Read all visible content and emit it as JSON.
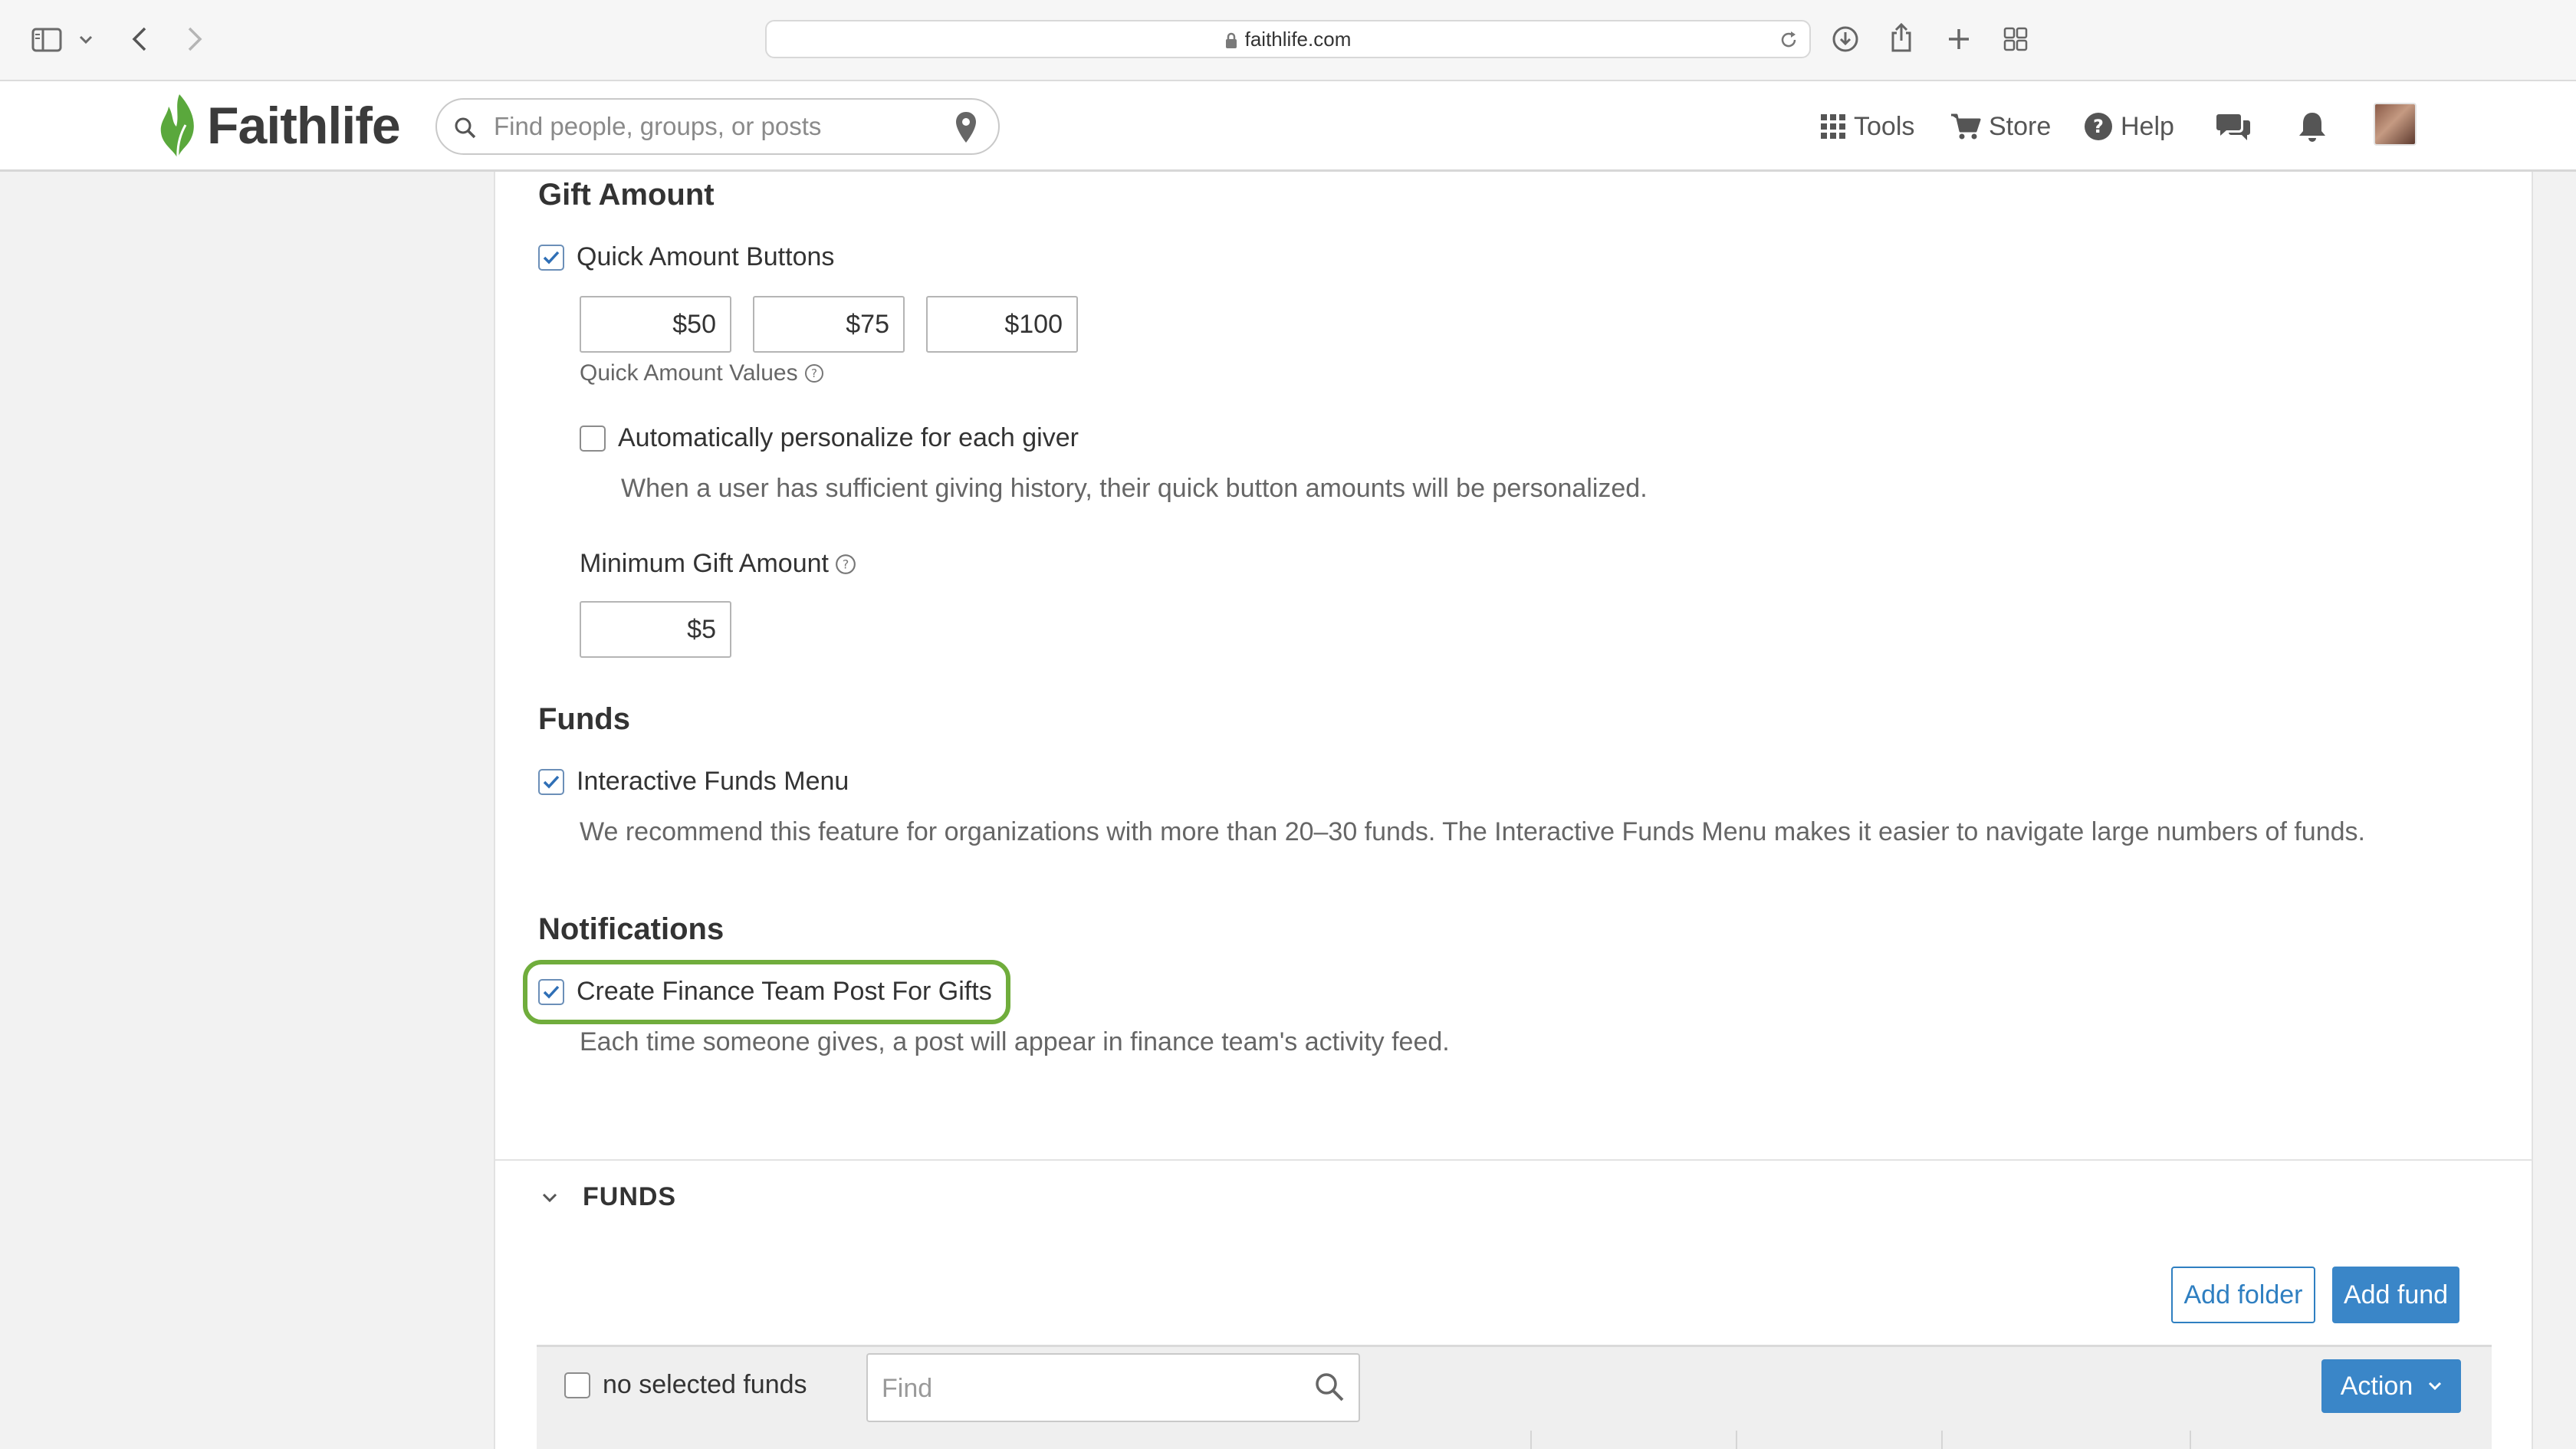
{
  "browser": {
    "url": "faithlife.com"
  },
  "header": {
    "logo_text": "Faithlife",
    "search_placeholder": "Find people, groups, or posts",
    "nav": {
      "tools": "Tools",
      "store": "Store",
      "help": "Help"
    }
  },
  "gift_amount": {
    "title": "Gift Amount",
    "quick_buttons_label": "Quick Amount Buttons",
    "quick_buttons_checked": true,
    "quick_values": [
      "$50",
      "$75",
      "$100"
    ],
    "quick_values_label": "Quick Amount Values",
    "personalize_label": "Automatically personalize for each giver",
    "personalize_checked": false,
    "personalize_help": "When a user has sufficient giving history, their quick button amounts will be personalized.",
    "minimum_label": "Minimum Gift Amount",
    "minimum_value": "$5"
  },
  "funds_settings": {
    "title": "Funds",
    "interactive_label": "Interactive Funds Menu",
    "interactive_checked": true,
    "interactive_help": "We recommend this feature for organizations with more than 20–30 funds. The Interactive Funds Menu makes it easier to navigate large numbers of funds."
  },
  "notifications": {
    "title": "Notifications",
    "finance_post_label": "Create Finance Team Post For Gifts",
    "finance_post_checked": true,
    "finance_post_help": "Each time someone gives, a post will appear in finance team's activity feed."
  },
  "funds_section": {
    "title": "FUNDS",
    "add_folder": "Add folder",
    "add_fund": "Add fund",
    "no_selected": "no selected funds",
    "find_placeholder": "Find",
    "action": "Action"
  },
  "colors": {
    "accent_blue": "#3a86c8",
    "highlight_green": "#70ad3c",
    "logo_green": "#5aa83c"
  }
}
